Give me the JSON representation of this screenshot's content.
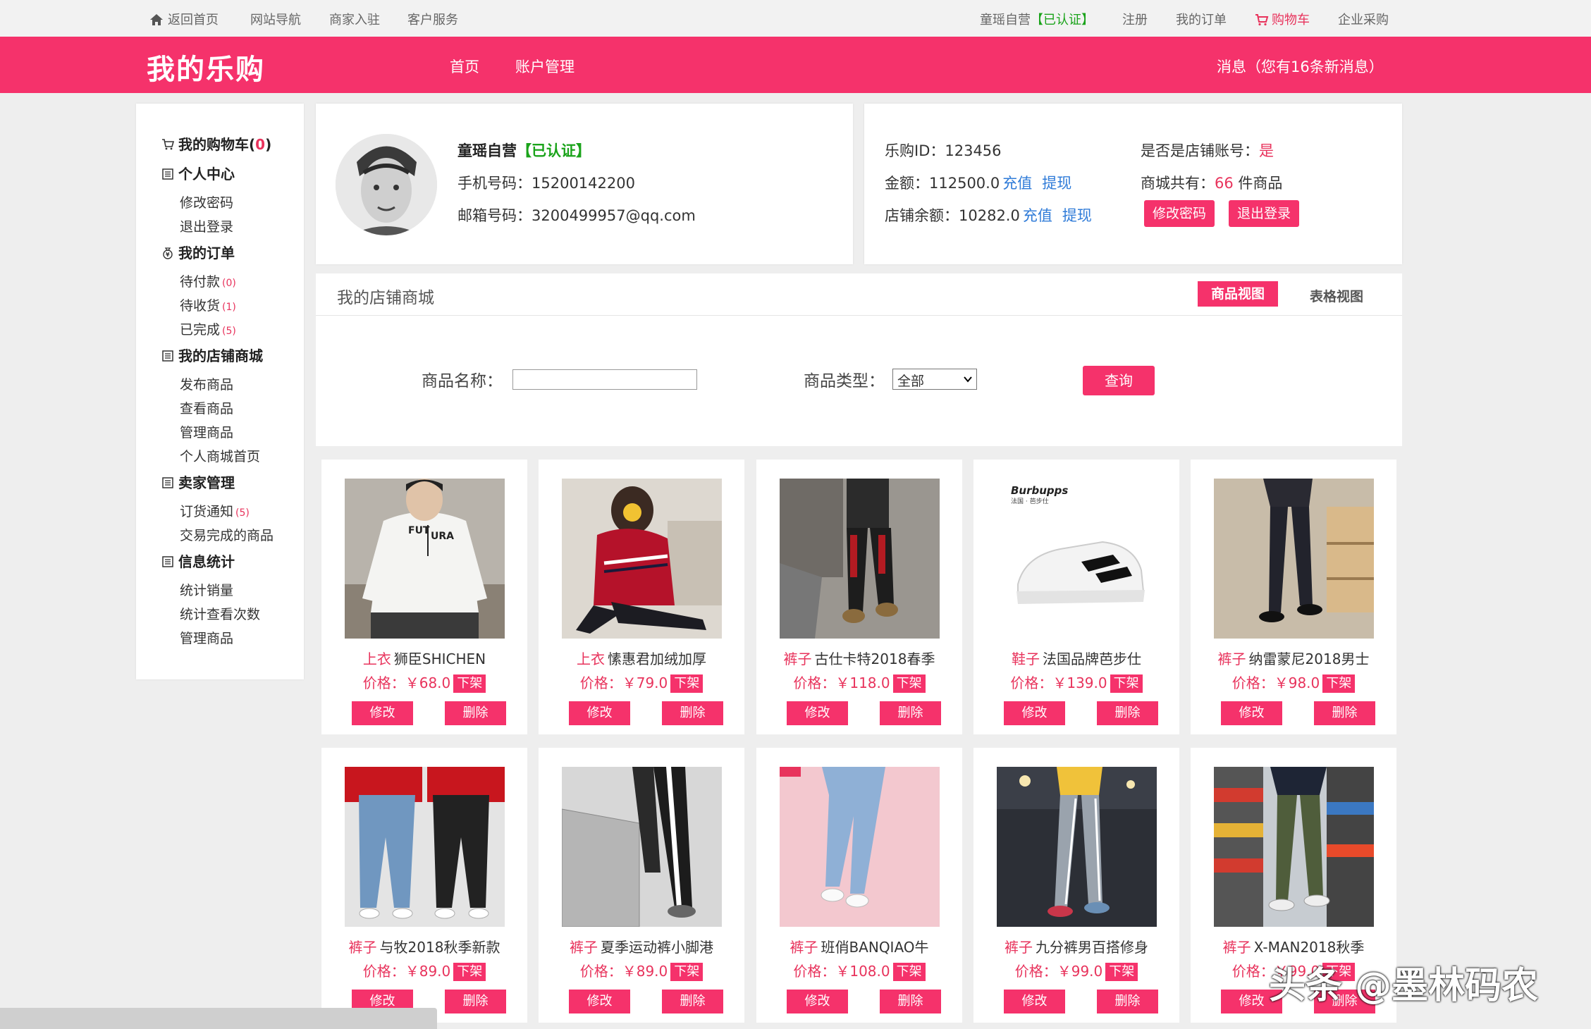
{
  "topbar": {
    "home": "返回首页",
    "site_nav": "网站导航",
    "merchant_join": "商家入驻",
    "customer_service": "客户服务",
    "store_name": "童瑶自营",
    "verified": "【已认证】",
    "register": "注册",
    "my_orders": "我的订单",
    "cart": "购物车",
    "enterprise": "企业采购"
  },
  "header": {
    "logo": "我的乐购",
    "nav": [
      "首页",
      "账户管理"
    ],
    "messages": "消息（您有16条新消息）"
  },
  "sidebar": {
    "cart_label": "我的购物车(",
    "cart_count": "0",
    "cart_close": ")",
    "personal_center": "个人中心",
    "change_password": "修改密码",
    "logout": "退出登录",
    "my_orders": "我的订单",
    "pending_payment": "待付款",
    "pending_payment_count": "(0)",
    "pending_receipt": "待收货",
    "pending_receipt_count": "(1)",
    "completed": "已完成",
    "completed_count": "(5)",
    "my_store": "我的店铺商城",
    "publish": "发布商品",
    "view": "查看商品",
    "manage": "管理商品",
    "personal_home": "个人商城首页",
    "seller_mgmt": "卖家管理",
    "order_notice": "订货通知",
    "order_notice_count": "(5)",
    "traded_goods": "交易完成的商品",
    "stats": "信息统计",
    "stat_sales": "统计销量",
    "stat_views": "统计查看次数",
    "stat_manage": "管理商品"
  },
  "profile": {
    "name": "童瑶自营",
    "verified": "【已认证】",
    "phone": "手机号码：15200142200",
    "email": "邮箱号码：3200499957@qq.com"
  },
  "account": {
    "id": "乐购ID：123456",
    "is_store_label": "是否是店铺账号：",
    "is_store_value": "是",
    "balance": "金额：112500.0",
    "recharge": "充值",
    "withdraw": "提现",
    "goods_prefix": "商城共有：",
    "goods_count": "66",
    "goods_suffix": "件商品",
    "store_balance": "店铺余额：10282.0",
    "change_password": "修改密码",
    "logout": "退出登录"
  },
  "store": {
    "title": "我的店铺商城",
    "tab_goods": "商品视图",
    "tab_table": "表格视图",
    "name_label": "商品名称：",
    "name_value": "",
    "type_label": "商品类型：",
    "type_selected": "全部",
    "query": "查询"
  },
  "product_buttons": {
    "edit": "修改",
    "delete": "删除",
    "delist": "下架"
  },
  "products": [
    {
      "category": "上衣",
      "name": "狮臣SHICHEN",
      "price": "价格：￥68.0",
      "img": "sweatshirt"
    },
    {
      "category": "上衣",
      "name": "愫惠君加绒加厚",
      "price": "价格：￥79.0",
      "img": "red-sweater"
    },
    {
      "category": "裤子",
      "name": "古仕卡特2018春季",
      "price": "价格：￥118.0",
      "img": "cargo-pants"
    },
    {
      "category": "鞋子",
      "name": "法国品牌芭步仕",
      "price": "价格：￥139.0",
      "img": "sneaker"
    },
    {
      "category": "裤子",
      "name": "纳雷蒙尼2018男士",
      "price": "价格：￥98.0",
      "img": "slim-pants"
    },
    {
      "category": "裤子",
      "name": "与牧2018秋季新款",
      "price": "价格：￥89.0",
      "img": "jeans-pair"
    },
    {
      "category": "裤子",
      "name": "夏季运动裤小脚港",
      "price": "价格：￥89.0",
      "img": "track-pants"
    },
    {
      "category": "裤子",
      "name": "班俏BANQIAO牛",
      "price": "价格：￥108.0",
      "img": "light-jeans"
    },
    {
      "category": "裤子",
      "name": "九分裤男百搭修身",
      "price": "价格：￥99.0",
      "img": "stripe-pants"
    },
    {
      "category": "裤子",
      "name": "X-MAN2018秋季",
      "price": "价格：￥99.0",
      "img": "green-cargo"
    }
  ],
  "sneaker_brand": "Burbupps",
  "sneaker_brand_sub": "法国 · 芭步仕",
  "watermark": "头条 @墨林码农",
  "colors": {
    "accent": "#f5326b",
    "link": "#2f7bd8",
    "verified": "#1aa31a"
  }
}
